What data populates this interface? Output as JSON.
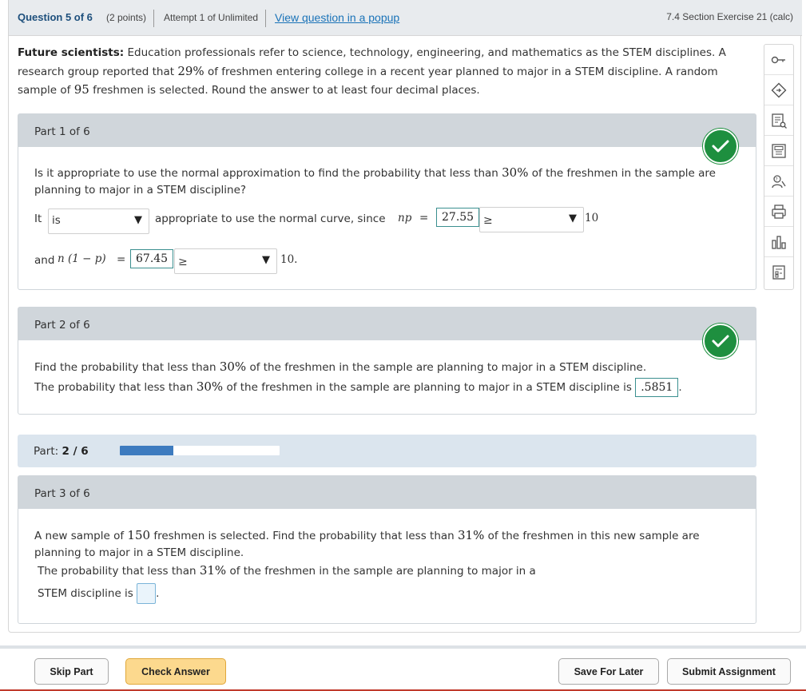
{
  "header": {
    "question": "Question 5 of 6",
    "points": "(2 points)",
    "attempt": "Attempt 1 of Unlimited",
    "popup_link": "View question in a popup",
    "section": "7.4 Section Exercise 21 (calc)"
  },
  "intro": {
    "lead": "Future scientists:",
    "t1": " Education professionals refer to science, technology, engineering, and mathematics as the STEM disciplines. A research group reported that ",
    "pct": "29%",
    "t2": " of freshmen entering college in a recent year planned to major in a STEM discipline. A random sample of ",
    "n": "95",
    "t3": " freshmen is selected. Round the answer to at least four decimal places."
  },
  "tools": [
    "key-icon",
    "tag-icon",
    "notes-search-icon",
    "calculator-icon",
    "help-person-icon",
    "printer-icon",
    "bar-chart-icon",
    "datasheet-icon"
  ],
  "part1": {
    "title": "Part 1 of 6",
    "q1": "Is it appropriate to use the normal approximation to find the probability that less than ",
    "q_pct": "30%",
    "q2": " of the freshmen in the sample are planning to major in a STEM discipline?",
    "it": "It",
    "select1": "is",
    "approp": "appropriate to use the normal curve, since",
    "np": "np",
    "eq": "=",
    "np_val": "27.55",
    "ge1": "≥",
    "ten1": "10",
    "and": "and",
    "nq": "n (1 − p)",
    "eq2": "=",
    "nq_val": "67.45",
    "ge2": "≥",
    "ten2": "10."
  },
  "part2": {
    "title": "Part 2 of 6",
    "l1a": "Find the probability that less than ",
    "pct": "30%",
    "l1b": " of the freshmen in the sample are planning to major in a STEM discipline.",
    "l2a": "The probability that less than ",
    "l2b": " of the freshmen in the sample are planning to major in a STEM discipline is",
    "answer": ".5851",
    "period": "."
  },
  "progress": {
    "label": "Part:",
    "value": "2 / 6",
    "fraction": 0.333
  },
  "part3": {
    "title": "Part 3 of 6",
    "l1a": "A new sample of ",
    "n": "150",
    "l1b": " freshmen is selected. Find the probability that less than ",
    "pct": "31%",
    "l1c": " of the freshmen in this new sample are planning to major in a STEM discipline.",
    "l2a": "The probability that less than ",
    "l2b": " of the freshmen in the sample are planning to major in a",
    "l3": "STEM discipline is",
    "period": "."
  },
  "footer": {
    "skip": "Skip Part",
    "check": "Check Answer",
    "save": "Save For Later",
    "submit": "Submit Assignment"
  },
  "colors": {
    "correct": "#1e8f3f",
    "progress": "#3d7bbf",
    "check_button": "#fcd98e",
    "link": "#1a73b8"
  }
}
